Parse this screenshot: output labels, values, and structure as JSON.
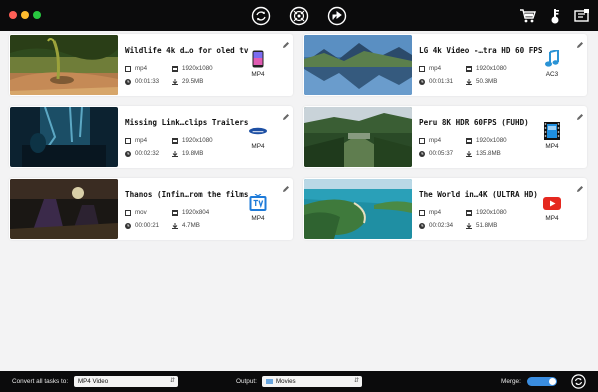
{
  "toolbar": {
    "window_controls": [
      "close",
      "minimize",
      "maximize"
    ],
    "center_icons": [
      "convert-tab-icon",
      "download-tab-icon",
      "toolbox-tab-icon"
    ],
    "right_icons": [
      "cart-icon",
      "key-icon",
      "feedback-icon"
    ]
  },
  "videos": [
    {
      "title": "Wildlife 4k d…o for oled tv",
      "format": "mp4",
      "resolution": "1920x1080",
      "duration": "00:01:33",
      "size": "29.5MB",
      "target": "MP4",
      "target_icon": "phone-icon"
    },
    {
      "title": "LG 4k Video -…tra HD 60 FPS",
      "format": "mp4",
      "resolution": "1920x1080",
      "duration": "00:01:31",
      "size": "50.3MB",
      "target": "AC3",
      "target_icon": "music-note-icon"
    },
    {
      "title": "Missing Link…clips Trailers",
      "format": "mp4",
      "resolution": "1920x1080",
      "duration": "00:02:32",
      "size": "19.8MB",
      "target": "MP4",
      "target_icon": "samsung-logo-icon"
    },
    {
      "title": "Peru 8K HDR 60FPS (FUHD)",
      "format": "mp4",
      "resolution": "1920x1080",
      "duration": "00:05:37",
      "size": "135.8MB",
      "target": "MP4",
      "target_icon": "film-strip-icon"
    },
    {
      "title": "Thanos (Infin…rom the films",
      "format": "mov",
      "resolution": "1920x804",
      "duration": "00:00:21",
      "size": "4.7MB",
      "target": "MP4",
      "target_icon": "tv-icon"
    },
    {
      "title": "The World in…4K (ULTRA HD)",
      "format": "mp4",
      "resolution": "1920x1080",
      "duration": "00:02:34",
      "size": "51.8MB",
      "target": "MP4",
      "target_icon": "youtube-icon"
    }
  ],
  "bottom": {
    "convert_all_label": "Convert all tasks to:",
    "convert_all_value": "MP4 Video",
    "output_label": "Output:",
    "output_value": "Movies",
    "merge_label": "Merge:",
    "merge_on": true
  },
  "colors": {
    "accent": "#3a8de0",
    "toolbar_bg": "#0b0b0c",
    "content_bg": "#f3f3f4"
  }
}
